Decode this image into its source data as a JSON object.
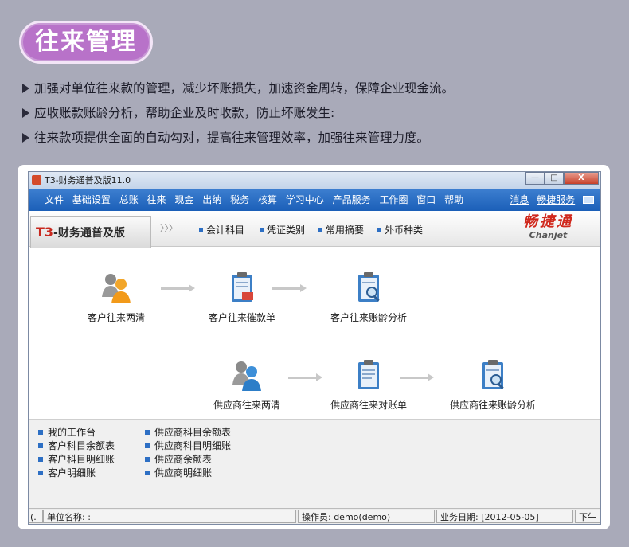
{
  "heading": "往来管理",
  "bullets": [
    "加强对单位往来款的管理，减少坏账损失，加速资金周转，保障企业现金流。",
    "应收账款账龄分析，帮助企业及时收款，防止坏账发生:",
    "往来款项提供全面的自动勾对，提高往来管理效率，加强往来管理力度。"
  ],
  "window": {
    "title": "T3-财务通普及版11.0",
    "buttons": {
      "minimize": "—",
      "maximize": "□",
      "close": "X"
    }
  },
  "menu": {
    "items": [
      "文件",
      "基础设置",
      "总账",
      "往来",
      "现金",
      "出纳",
      "税务",
      "核算",
      "学习中心",
      "产品服务",
      "工作圈",
      "窗口",
      "帮助"
    ],
    "right": {
      "message": "消息",
      "service": "畅捷服务"
    }
  },
  "toolbar": {
    "brand_prefix": "T3",
    "brand_rest": "-财务通普及版",
    "chevron": "〉〉〉",
    "quick_links": [
      "会计科目",
      "凭证类别",
      "常用摘要",
      "外币种类"
    ],
    "logo_cn": "畅捷通",
    "logo_en": "Chanjet"
  },
  "flow": {
    "row1": [
      "客户往来两清",
      "客户往来催款单",
      "客户往来账龄分析"
    ],
    "row2": [
      "供应商往来两清",
      "供应商往来对账单",
      "供应商往来账龄分析"
    ]
  },
  "reports": {
    "col1": [
      "我的工作台",
      "客户科目余额表",
      "客户科目明细账",
      "客户明细账"
    ],
    "col2": [
      "供应商科目余额表",
      "供应商科目明细账",
      "供应商余额表",
      "供应商明细账"
    ]
  },
  "status": {
    "left_fragment": "(.",
    "unit": "单位名称: :",
    "operator": "操作员: demo(demo)",
    "date": "业务日期: [2012-05-05]",
    "period": "下午"
  },
  "colors": {
    "page_bg": "#a9aab9",
    "heading_pill": "#b872c9",
    "menubar": "#1b5fb8",
    "logo_red": "#d0281c"
  },
  "icons": {
    "two_clear": "people-icon",
    "dunning": "clipboard-icon",
    "aging": "clipboard-magnifier-icon"
  }
}
